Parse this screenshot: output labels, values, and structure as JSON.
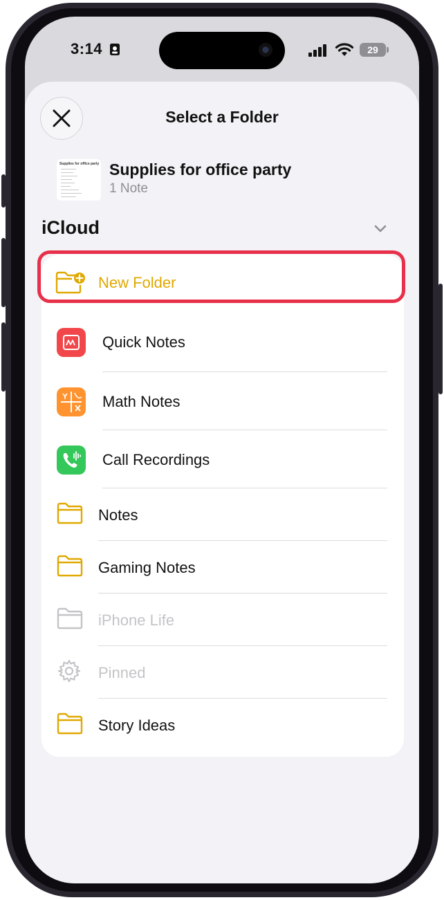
{
  "status_bar": {
    "time": "3:14",
    "battery": "29"
  },
  "sheet": {
    "title": "Select a Folder",
    "note": {
      "name": "Supplies for office party",
      "count": "1 Note",
      "thumbnail_title": "Supplies for office party"
    },
    "section_title": "iCloud",
    "folders": [
      {
        "label": "New Folder",
        "icon": "folder-add-icon",
        "state": "accent"
      },
      {
        "label": "Quick Notes",
        "icon": "quick-notes-icon",
        "state": "normal"
      },
      {
        "label": "Math Notes",
        "icon": "math-notes-icon",
        "state": "normal"
      },
      {
        "label": "Call Recordings",
        "icon": "call-recordings-icon",
        "state": "normal"
      },
      {
        "label": "Notes",
        "icon": "folder-icon",
        "state": "normal"
      },
      {
        "label": "Gaming Notes",
        "icon": "folder-icon",
        "state": "normal"
      },
      {
        "label": "iPhone Life",
        "icon": "folder-icon",
        "state": "disabled"
      },
      {
        "label": "Pinned",
        "icon": "gear-icon",
        "state": "disabled"
      },
      {
        "label": "Story Ideas",
        "icon": "folder-icon",
        "state": "normal"
      }
    ]
  },
  "colors": {
    "accent": "#e0a800",
    "highlight": "#e8304a",
    "quick_notes": "#f2474a",
    "math_notes": "#ff9330",
    "call_recordings": "#34c759"
  }
}
